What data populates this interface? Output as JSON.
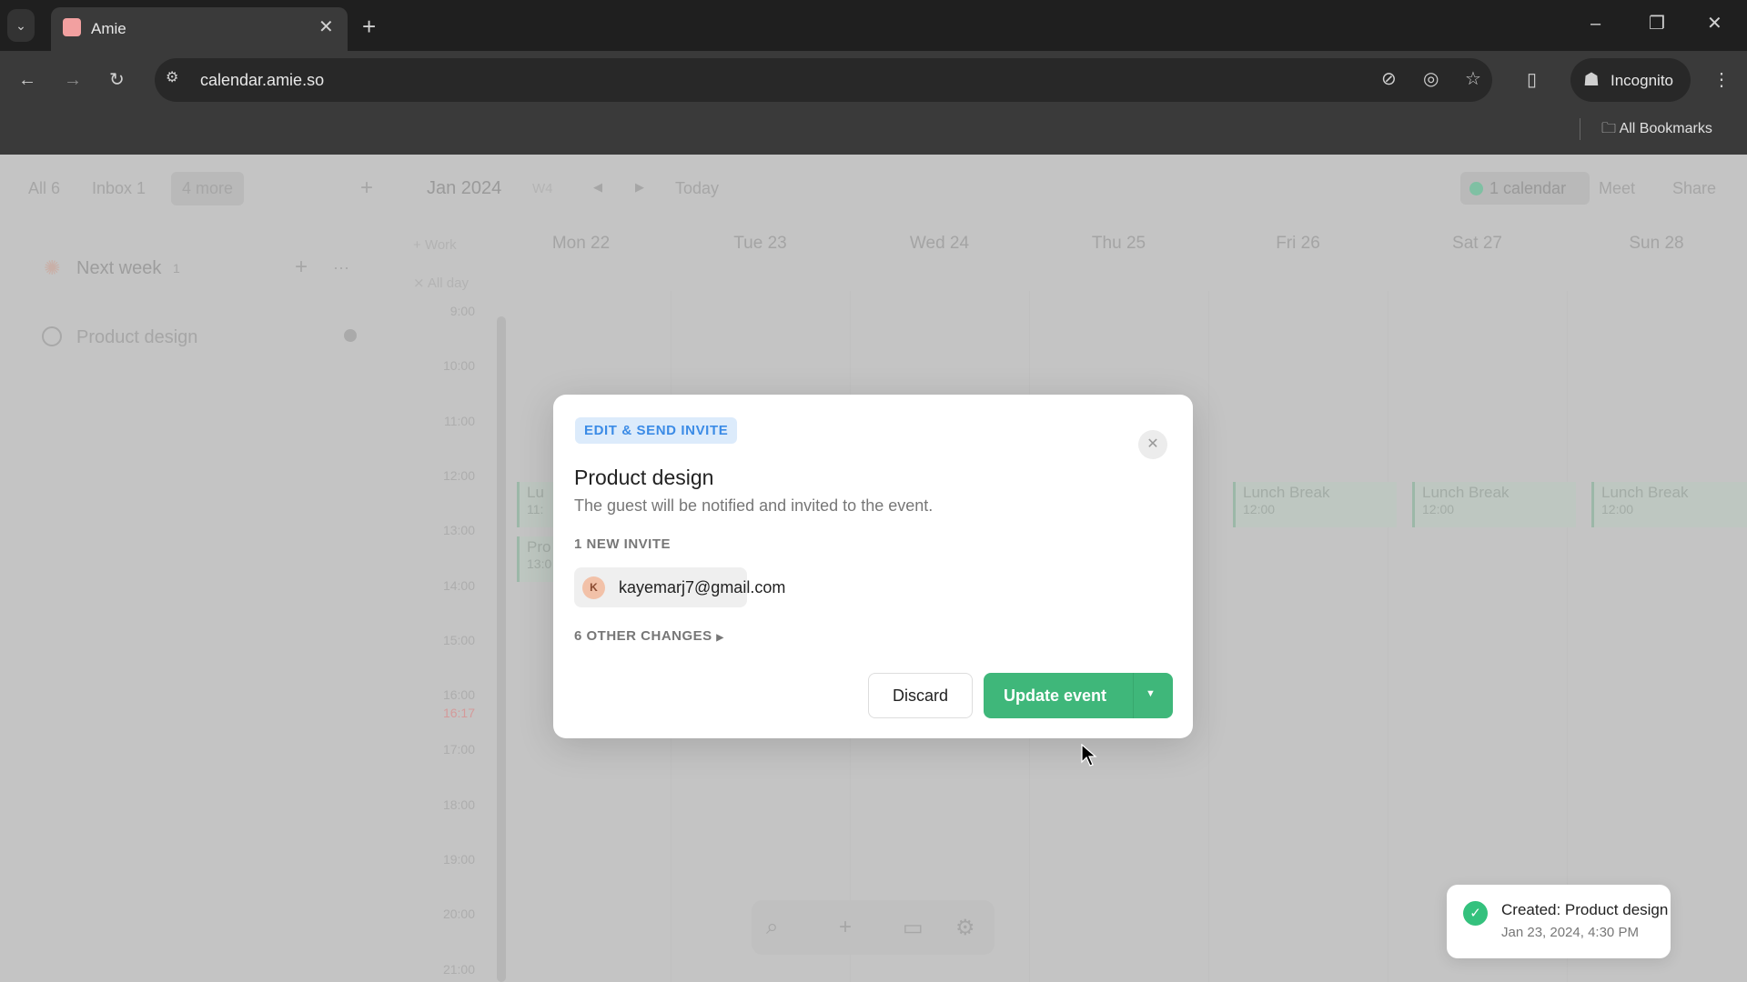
{
  "browser": {
    "tab_title": "Amie",
    "url": "calendar.amie.so",
    "profile": "Incognito",
    "bookmarks": "All Bookmarks"
  },
  "sidebar": {
    "filters": [
      "All 6",
      "Inbox 1",
      "4 more"
    ],
    "section": {
      "title": "Next week",
      "count": "1"
    },
    "items": [
      {
        "label": "Product design"
      }
    ]
  },
  "calendar": {
    "month": "Jan 2024",
    "week": "W4",
    "today": "Today",
    "calendars": "1 calendar",
    "meet": "Meet",
    "share": "Share",
    "work_label": "Work",
    "allday_label": "All day",
    "days": [
      "Mon 22",
      "Tue 23",
      "Wed 24",
      "Thu 25",
      "Fri 26",
      "Sat 27",
      "Sun 28"
    ],
    "times": [
      "9:00",
      "10:00",
      "11:00",
      "12:00",
      "13:00",
      "14:00",
      "15:00",
      "16:00",
      "17:00",
      "18:00",
      "19:00",
      "20:00",
      "21:00"
    ],
    "now": "16:17",
    "events": [
      {
        "title": "Lu",
        "time": "11:",
        "day": "Mon 22"
      },
      {
        "title": "Pro",
        "time": "13:0",
        "day": "Mon 22"
      },
      {
        "title": "Lunch Break",
        "time": "12:00",
        "day": "Fri 26"
      },
      {
        "title": "Lunch Break",
        "time": "12:00",
        "day": "Sat 27"
      },
      {
        "title": "Lunch Break",
        "time": "12:00",
        "day": "Sun 28"
      }
    ]
  },
  "modal": {
    "badge": "EDIT & SEND INVITE",
    "title": "Product design",
    "description": "The guest will be notified and invited to the event.",
    "invite_header": "1 NEW INVITE",
    "invitee": {
      "initial": "K",
      "email": "kayemarj7@gmail.com"
    },
    "other_changes": "6 OTHER CHANGES",
    "discard": "Discard",
    "update": "Update event",
    "accent": "#3fb77a"
  },
  "toast": {
    "title": "Created: Product design",
    "subtitle": "Jan 23, 2024, 4:30 PM"
  }
}
